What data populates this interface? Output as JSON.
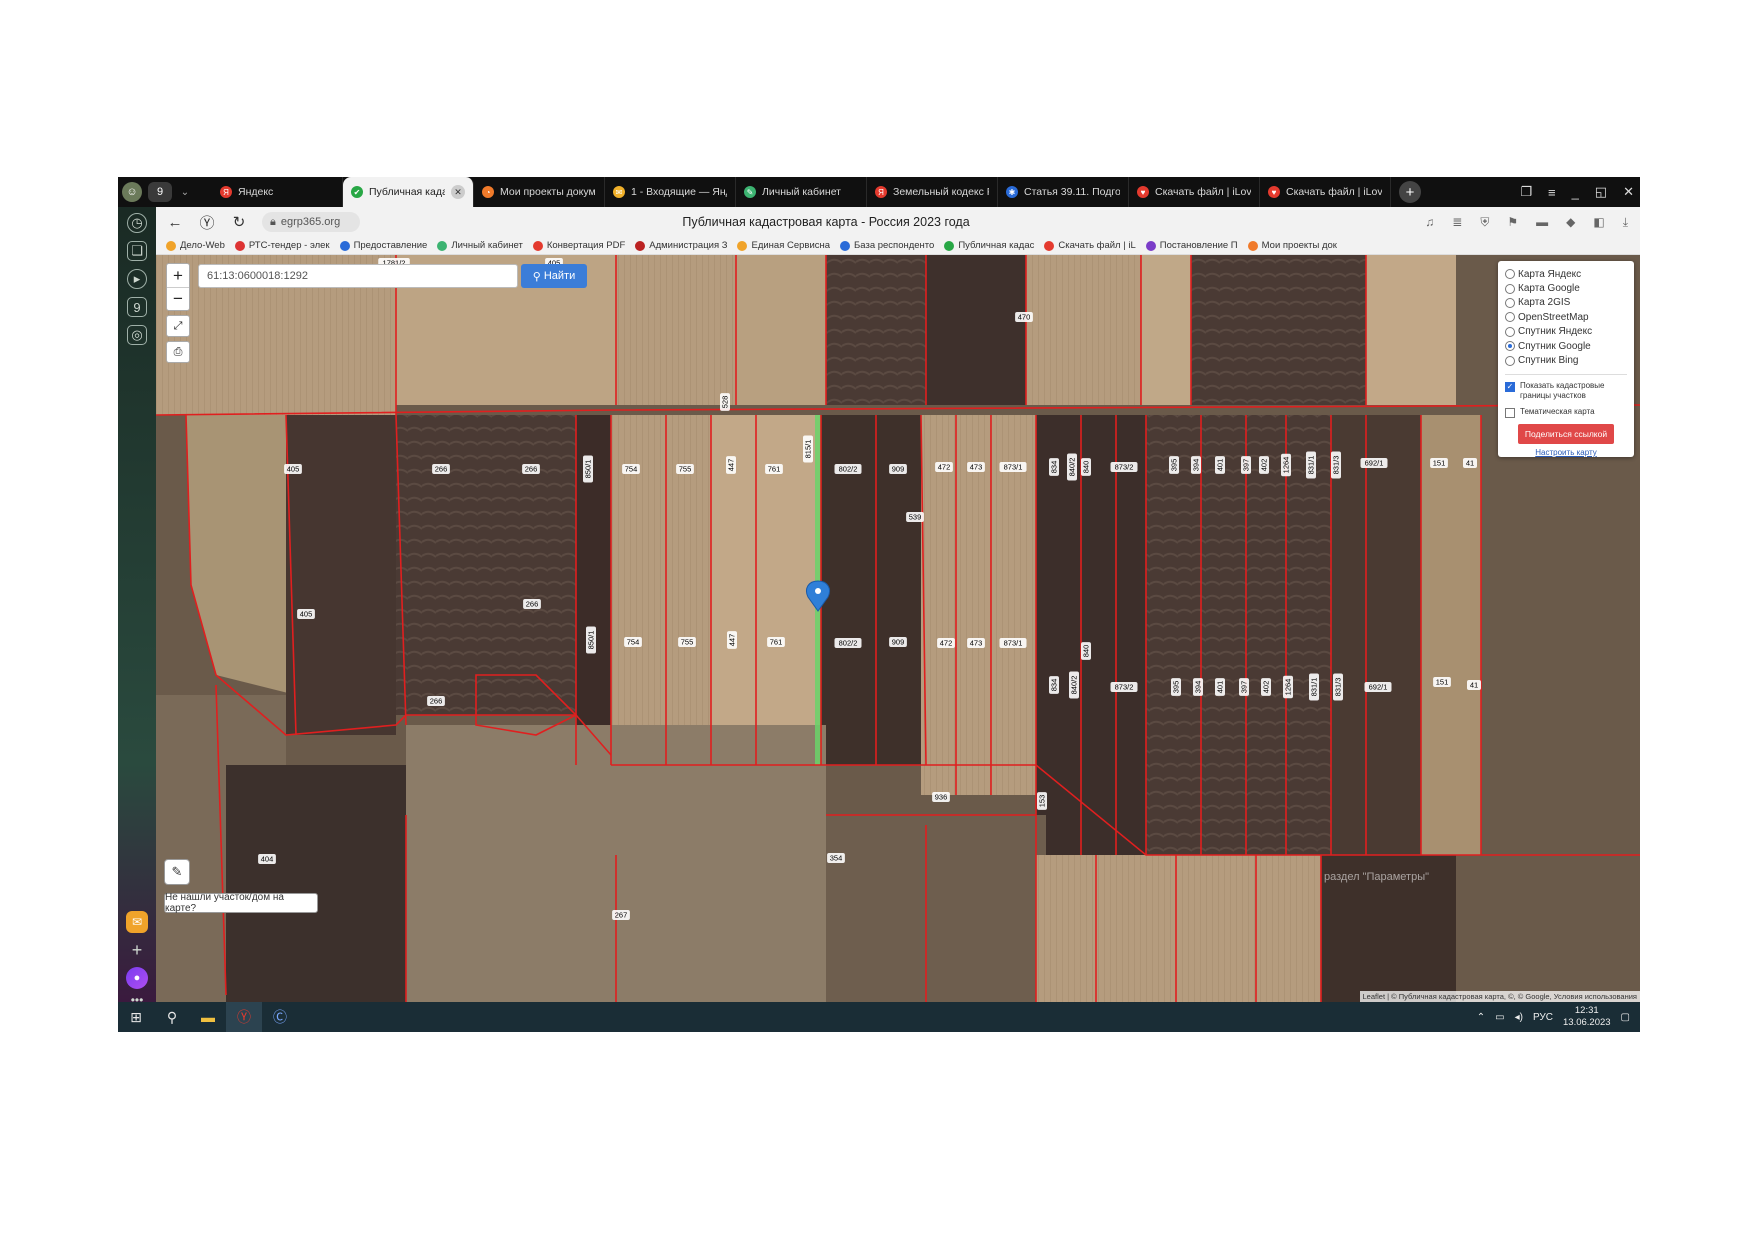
{
  "browser": {
    "tab_count": "9",
    "tabs": [
      {
        "label": "Яндекс",
        "color": "#e43a2e",
        "icon": "Я"
      },
      {
        "label": "Публичная кадас",
        "color": "#28a745",
        "icon": "✔",
        "active": true
      },
      {
        "label": "Мои проекты докум",
        "color": "#f07a2a",
        "icon": "◔"
      },
      {
        "label": "1 - Входящие — Янд",
        "color": "#f0b02a",
        "icon": "✉"
      },
      {
        "label": "Личный кабинет",
        "color": "#3cb371",
        "icon": "✎"
      },
      {
        "label": "Земельный кодекс Р",
        "color": "#e43a2e",
        "icon": "Я"
      },
      {
        "label": "Статья 39.11. Подгот",
        "color": "#2a6bd8",
        "icon": "✱"
      },
      {
        "label": "Скачать файл | iLove",
        "color": "#e43a2e",
        "icon": "♥"
      },
      {
        "label": "Скачать файл | iLove",
        "color": "#e43a2e",
        "icon": "♥"
      }
    ],
    "url": "egrp365.org",
    "page_title": "Публичная кадастровая карта - Россия 2023 года",
    "bookmarks": [
      {
        "label": "Дело-Web",
        "color": "#f0a32a"
      },
      {
        "label": "РТС-тендер - элек",
        "color": "#d33"
      },
      {
        "label": "Предоставление",
        "color": "#2a6bd8"
      },
      {
        "label": "Личный кабинет",
        "color": "#3cb371"
      },
      {
        "label": "Конвертация PDF",
        "color": "#e43a2e"
      },
      {
        "label": "Администрация З",
        "color": "#b22"
      },
      {
        "label": "Единая Сервисна",
        "color": "#f0a32a"
      },
      {
        "label": "База респонденто",
        "color": "#2a6bd8"
      },
      {
        "label": "Публичная кадас",
        "color": "#28a745"
      },
      {
        "label": "Скачать файл | iL",
        "color": "#e43a2e"
      },
      {
        "label": "Постановление П",
        "color": "#7a3cc8"
      },
      {
        "label": "Мои проекты док",
        "color": "#f07a2a"
      }
    ]
  },
  "map": {
    "search_value": "61:13:0600018:1292",
    "search_button": "Найти",
    "layers": [
      {
        "label": "Карта Яндекс",
        "selected": false
      },
      {
        "label": "Карта Google",
        "selected": false
      },
      {
        "label": "Карта 2GIS",
        "selected": false
      },
      {
        "label": "OpenStreetMap",
        "selected": false
      },
      {
        "label": "Спутник Яндекс",
        "selected": false
      },
      {
        "label": "Спутник Google",
        "selected": true
      },
      {
        "label": "Спутник Bing",
        "selected": false
      }
    ],
    "show_boundaries_label": "Показать кадастровые границы участков",
    "show_boundaries_checked": true,
    "thematic_label": "Тематическая карта",
    "thematic_checked": false,
    "share_button": "Поделиться ссылкой",
    "configure_link": "Настроить карту",
    "not_found_label": "Не нашли участок/дом на карте?",
    "attribution": "Leaflet | © Публичная кадастровая карта, ©, © Google, Условия использования",
    "watermark": "раздел \"Параметры\"",
    "parcel_labels": [
      "405",
      "266",
      "266",
      "850/1",
      "754",
      "755",
      "447",
      "761",
      "815/1",
      "802/2",
      "909",
      "472",
      "473",
      "873/1",
      "834",
      "840/2",
      "840",
      "873/2",
      "395",
      "394",
      "401",
      "397",
      "402",
      "1264",
      "831/1",
      "831/3",
      "692/1",
      "151",
      "41",
      "539",
      "266",
      "405",
      "266",
      "850/1",
      "754",
      "755",
      "447",
      "761",
      "802/2",
      "909",
      "472",
      "473",
      "873/1",
      "840",
      "834",
      "840/2",
      "873/2",
      "395",
      "394",
      "401",
      "397",
      "402",
      "1264",
      "831/1",
      "831/3",
      "692/1",
      "151",
      "41",
      "404",
      "354",
      "267",
      "936",
      "153",
      "470",
      "528",
      "405",
      "1781/2"
    ]
  },
  "taskbar": {
    "language": "РУС",
    "time": "12:31",
    "date": "13.06.2023"
  }
}
